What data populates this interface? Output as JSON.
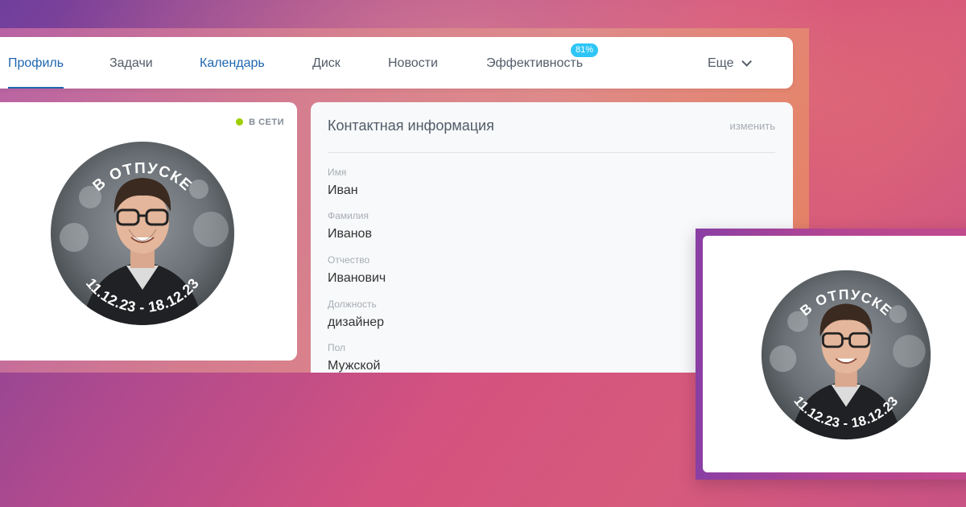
{
  "nav": {
    "items": [
      {
        "label": "Профиль"
      },
      {
        "label": "Задачи"
      },
      {
        "label": "Календарь"
      },
      {
        "label": "Диск"
      },
      {
        "label": "Новости"
      },
      {
        "label": "Эффективность"
      }
    ],
    "efficiency_badge": "81%",
    "more_label": "Еще"
  },
  "profile": {
    "status": "В СЕТИ",
    "avatar_top_text": "В ОТПУСКЕ",
    "avatar_bottom_text": "11.12.23 - 18.12.23"
  },
  "contact": {
    "title": "Контактная информация",
    "edit_label": "изменить",
    "fields": [
      {
        "label": "Имя",
        "value": "Иван"
      },
      {
        "label": "Фамилия",
        "value": "Иванов"
      },
      {
        "label": "Отчество",
        "value": "Иванович"
      },
      {
        "label": "Должность",
        "value": "дизайнер"
      },
      {
        "label": "Пол",
        "value": "Мужской"
      }
    ]
  },
  "popup": {
    "avatar_top_text": "В ОТПУСКЕ",
    "avatar_bottom_text": "11.12.23 - 18.12.23"
  },
  "colors": {
    "accent": "#2067b0",
    "online": "#9dcf00",
    "badge": "#2fc6f6"
  }
}
